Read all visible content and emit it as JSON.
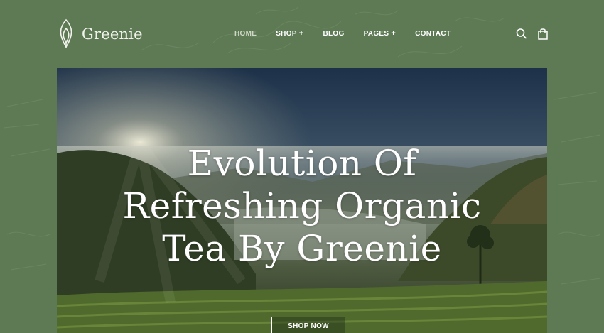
{
  "brand": {
    "name": "Greenie",
    "icon": "leaf-logo-icon"
  },
  "nav": {
    "items": [
      {
        "label": "HOME",
        "plus": ""
      },
      {
        "label": "SHOP",
        "plus": "+"
      },
      {
        "label": "BLOG",
        "plus": ""
      },
      {
        "label": "PAGES",
        "plus": "+"
      },
      {
        "label": "CONTACT",
        "plus": ""
      }
    ],
    "active": "HOME"
  },
  "header_icons": [
    "search-icon",
    "shopping-bag-icon"
  ],
  "hero": {
    "title_lines": [
      "Evolution Of",
      "Refreshing Organic",
      "Tea By Greenie"
    ],
    "cta_label": "SHOP NOW"
  },
  "colors": {
    "background": "#5e7a55",
    "text": "#ffffff"
  }
}
